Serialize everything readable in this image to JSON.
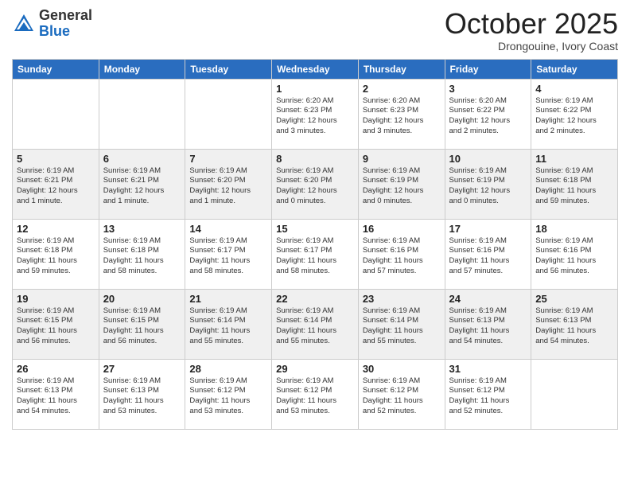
{
  "header": {
    "logo_line1": "General",
    "logo_line2": "Blue",
    "month": "October 2025",
    "location": "Drongouine, Ivory Coast"
  },
  "weekdays": [
    "Sunday",
    "Monday",
    "Tuesday",
    "Wednesday",
    "Thursday",
    "Friday",
    "Saturday"
  ],
  "weeks": [
    [
      {
        "day": "",
        "info": ""
      },
      {
        "day": "",
        "info": ""
      },
      {
        "day": "",
        "info": ""
      },
      {
        "day": "1",
        "info": "Sunrise: 6:20 AM\nSunset: 6:23 PM\nDaylight: 12 hours\nand 3 minutes."
      },
      {
        "day": "2",
        "info": "Sunrise: 6:20 AM\nSunset: 6:23 PM\nDaylight: 12 hours\nand 3 minutes."
      },
      {
        "day": "3",
        "info": "Sunrise: 6:20 AM\nSunset: 6:22 PM\nDaylight: 12 hours\nand 2 minutes."
      },
      {
        "day": "4",
        "info": "Sunrise: 6:19 AM\nSunset: 6:22 PM\nDaylight: 12 hours\nand 2 minutes."
      }
    ],
    [
      {
        "day": "5",
        "info": "Sunrise: 6:19 AM\nSunset: 6:21 PM\nDaylight: 12 hours\nand 1 minute."
      },
      {
        "day": "6",
        "info": "Sunrise: 6:19 AM\nSunset: 6:21 PM\nDaylight: 12 hours\nand 1 minute."
      },
      {
        "day": "7",
        "info": "Sunrise: 6:19 AM\nSunset: 6:20 PM\nDaylight: 12 hours\nand 1 minute."
      },
      {
        "day": "8",
        "info": "Sunrise: 6:19 AM\nSunset: 6:20 PM\nDaylight: 12 hours\nand 0 minutes."
      },
      {
        "day": "9",
        "info": "Sunrise: 6:19 AM\nSunset: 6:19 PM\nDaylight: 12 hours\nand 0 minutes."
      },
      {
        "day": "10",
        "info": "Sunrise: 6:19 AM\nSunset: 6:19 PM\nDaylight: 12 hours\nand 0 minutes."
      },
      {
        "day": "11",
        "info": "Sunrise: 6:19 AM\nSunset: 6:18 PM\nDaylight: 11 hours\nand 59 minutes."
      }
    ],
    [
      {
        "day": "12",
        "info": "Sunrise: 6:19 AM\nSunset: 6:18 PM\nDaylight: 11 hours\nand 59 minutes."
      },
      {
        "day": "13",
        "info": "Sunrise: 6:19 AM\nSunset: 6:18 PM\nDaylight: 11 hours\nand 58 minutes."
      },
      {
        "day": "14",
        "info": "Sunrise: 6:19 AM\nSunset: 6:17 PM\nDaylight: 11 hours\nand 58 minutes."
      },
      {
        "day": "15",
        "info": "Sunrise: 6:19 AM\nSunset: 6:17 PM\nDaylight: 11 hours\nand 58 minutes."
      },
      {
        "day": "16",
        "info": "Sunrise: 6:19 AM\nSunset: 6:16 PM\nDaylight: 11 hours\nand 57 minutes."
      },
      {
        "day": "17",
        "info": "Sunrise: 6:19 AM\nSunset: 6:16 PM\nDaylight: 11 hours\nand 57 minutes."
      },
      {
        "day": "18",
        "info": "Sunrise: 6:19 AM\nSunset: 6:16 PM\nDaylight: 11 hours\nand 56 minutes."
      }
    ],
    [
      {
        "day": "19",
        "info": "Sunrise: 6:19 AM\nSunset: 6:15 PM\nDaylight: 11 hours\nand 56 minutes."
      },
      {
        "day": "20",
        "info": "Sunrise: 6:19 AM\nSunset: 6:15 PM\nDaylight: 11 hours\nand 56 minutes."
      },
      {
        "day": "21",
        "info": "Sunrise: 6:19 AM\nSunset: 6:14 PM\nDaylight: 11 hours\nand 55 minutes."
      },
      {
        "day": "22",
        "info": "Sunrise: 6:19 AM\nSunset: 6:14 PM\nDaylight: 11 hours\nand 55 minutes."
      },
      {
        "day": "23",
        "info": "Sunrise: 6:19 AM\nSunset: 6:14 PM\nDaylight: 11 hours\nand 55 minutes."
      },
      {
        "day": "24",
        "info": "Sunrise: 6:19 AM\nSunset: 6:13 PM\nDaylight: 11 hours\nand 54 minutes."
      },
      {
        "day": "25",
        "info": "Sunrise: 6:19 AM\nSunset: 6:13 PM\nDaylight: 11 hours\nand 54 minutes."
      }
    ],
    [
      {
        "day": "26",
        "info": "Sunrise: 6:19 AM\nSunset: 6:13 PM\nDaylight: 11 hours\nand 54 minutes."
      },
      {
        "day": "27",
        "info": "Sunrise: 6:19 AM\nSunset: 6:13 PM\nDaylight: 11 hours\nand 53 minutes."
      },
      {
        "day": "28",
        "info": "Sunrise: 6:19 AM\nSunset: 6:12 PM\nDaylight: 11 hours\nand 53 minutes."
      },
      {
        "day": "29",
        "info": "Sunrise: 6:19 AM\nSunset: 6:12 PM\nDaylight: 11 hours\nand 53 minutes."
      },
      {
        "day": "30",
        "info": "Sunrise: 6:19 AM\nSunset: 6:12 PM\nDaylight: 11 hours\nand 52 minutes."
      },
      {
        "day": "31",
        "info": "Sunrise: 6:19 AM\nSunset: 6:12 PM\nDaylight: 11 hours\nand 52 minutes."
      },
      {
        "day": "",
        "info": ""
      }
    ]
  ]
}
